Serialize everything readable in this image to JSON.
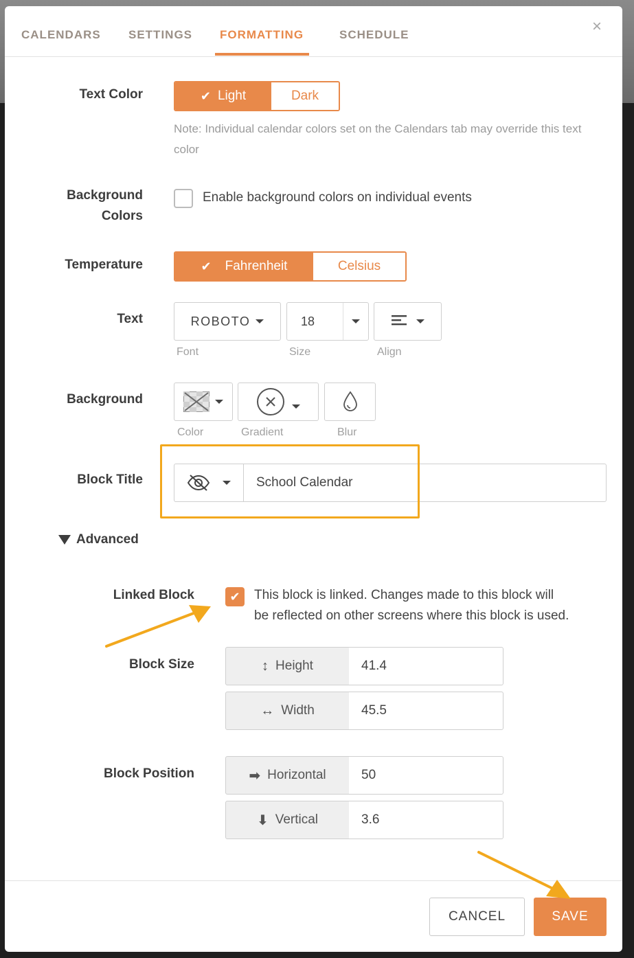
{
  "tabs": [
    {
      "label": "CALENDARS"
    },
    {
      "label": "SETTINGS"
    },
    {
      "label": "FORMATTING"
    },
    {
      "label": "SCHEDULE"
    }
  ],
  "active_tab": "FORMATTING",
  "close_glyph": "×",
  "text_color": {
    "label": "Text Color",
    "options": [
      "Light",
      "Dark"
    ],
    "selected": "Light",
    "note": "Note: Individual calendar colors set on the Calendars tab may override this text color"
  },
  "background_colors": {
    "label_line1": "Background",
    "label_line2": "Colors",
    "checkbox_label": "Enable background colors on individual events",
    "checked": false
  },
  "temperature": {
    "label": "Temperature",
    "options": [
      "Fahrenheit",
      "Celsius"
    ],
    "selected": "Fahrenheit"
  },
  "text": {
    "label": "Text",
    "font_value": "ROBOTO",
    "font_caption": "Font",
    "size_value": "18",
    "size_caption": "Size",
    "align_caption": "Align",
    "align_icon": "align-left-icon"
  },
  "background": {
    "label": "Background",
    "color_caption": "Color",
    "gradient_caption": "Gradient",
    "blur_caption": "Blur",
    "color_icon": "transparent-swatch-icon",
    "gradient_icon": "circle-x-icon",
    "blur_icon": "droplet-icon"
  },
  "block_title": {
    "label": "Block Title",
    "visibility_icon": "eye-off-icon",
    "value": "School Calendar"
  },
  "advanced": {
    "toggle_label": "Advanced",
    "expanded": true
  },
  "linked_block": {
    "label": "Linked Block",
    "checked": true,
    "text_line1": "This block is linked. Changes made to this block will",
    "text_line2": "be reflected on other screens where this block is used."
  },
  "block_size": {
    "label": "Block Size",
    "height_label": "Height",
    "height_value": "41.4",
    "width_label": "Width",
    "width_value": "45.5"
  },
  "block_position": {
    "label": "Block Position",
    "horizontal_label": "Horizontal",
    "horizontal_value": "50",
    "vertical_label": "Vertical",
    "vertical_value": "3.6"
  },
  "footer": {
    "cancel_label": "CANCEL",
    "save_label": "SAVE"
  },
  "colors": {
    "accent": "#e8894a",
    "annotation": "#f2a81d"
  }
}
